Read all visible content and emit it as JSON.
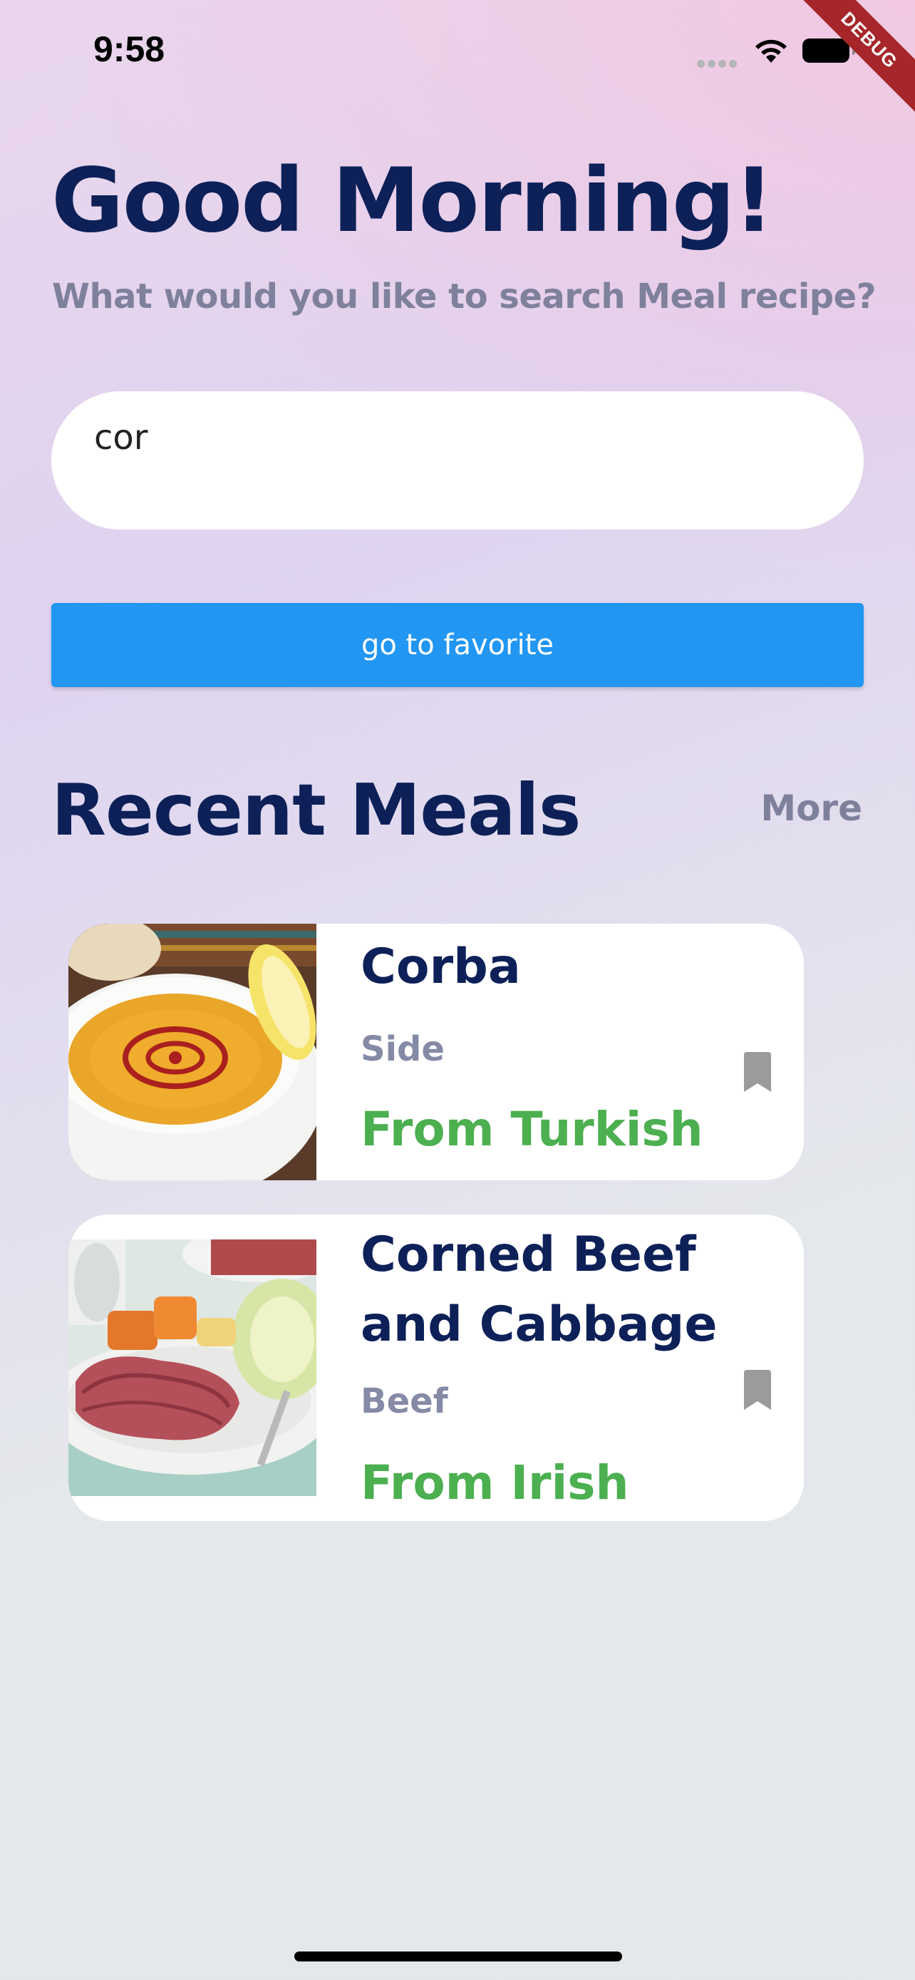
{
  "status_bar": {
    "time": "9:58"
  },
  "debug_banner": "DEBUG",
  "header": {
    "greeting": "Good Morning!",
    "subtitle": "What would you like to search Meal recipe?"
  },
  "search": {
    "value": "cor"
  },
  "favorite_button": {
    "label": "go to favorite"
  },
  "recent": {
    "title": "Recent Meals",
    "more_label": "More"
  },
  "meals": [
    {
      "name": "Corba",
      "category": "Side",
      "area": "From Turkish",
      "image_icon": "soup-bowl-photo",
      "bookmark_icon": "bookmark-icon"
    },
    {
      "name": "Corned Beef and Cabbage",
      "category": "Beef",
      "area": "From Irish",
      "image_icon": "corned-beef-plate-photo",
      "bookmark_icon": "bookmark-icon"
    }
  ],
  "colors": {
    "title": "#0d2058",
    "muted": "#7f819c",
    "button": "#2196f3",
    "area_green": "#4caf50",
    "debug": "#a6262a"
  }
}
